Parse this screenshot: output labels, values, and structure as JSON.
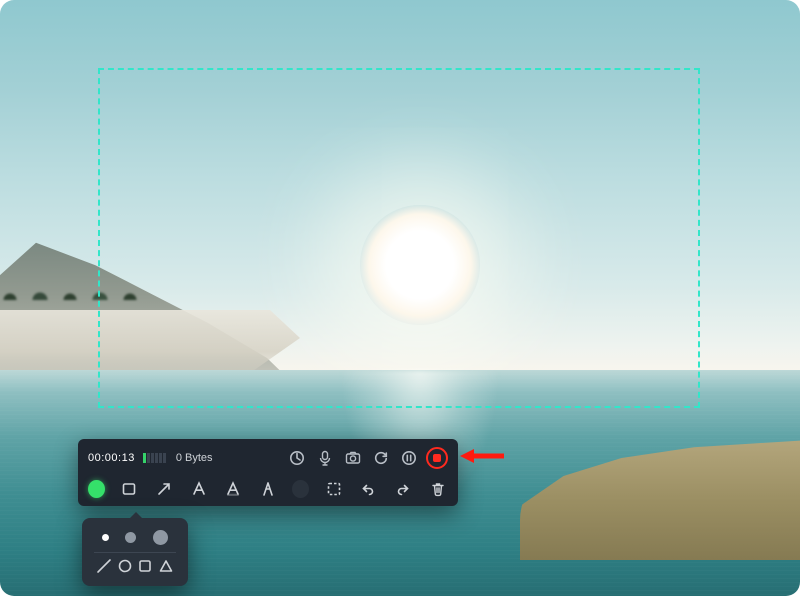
{
  "recording": {
    "timer": "00:00:13",
    "level_bars_on": 1,
    "level_bars_total": 6,
    "filesize": "0 Bytes"
  },
  "toolbar_top_icons": {
    "cursor": "cursor-highlight",
    "mic": "microphone",
    "camera": "camera",
    "restart": "restart",
    "pause": "pause",
    "stop": "stop"
  },
  "annotation_tools": {
    "color": "green",
    "rect": "rectangle",
    "arrow": "arrow",
    "text": "text",
    "highlighter": "highlighter",
    "caliper": "caliper",
    "brush_color": "dark",
    "marquee": "marquee",
    "undo": "undo",
    "redo": "redo",
    "trash": "trash"
  },
  "popover": {
    "sizes": [
      "small",
      "medium",
      "large"
    ],
    "shapes": [
      "line",
      "circle",
      "square",
      "triangle"
    ]
  },
  "colors": {
    "selection_border": "#32e6c9",
    "stop_red": "#ff2a1f",
    "active_green": "#35e06a"
  }
}
